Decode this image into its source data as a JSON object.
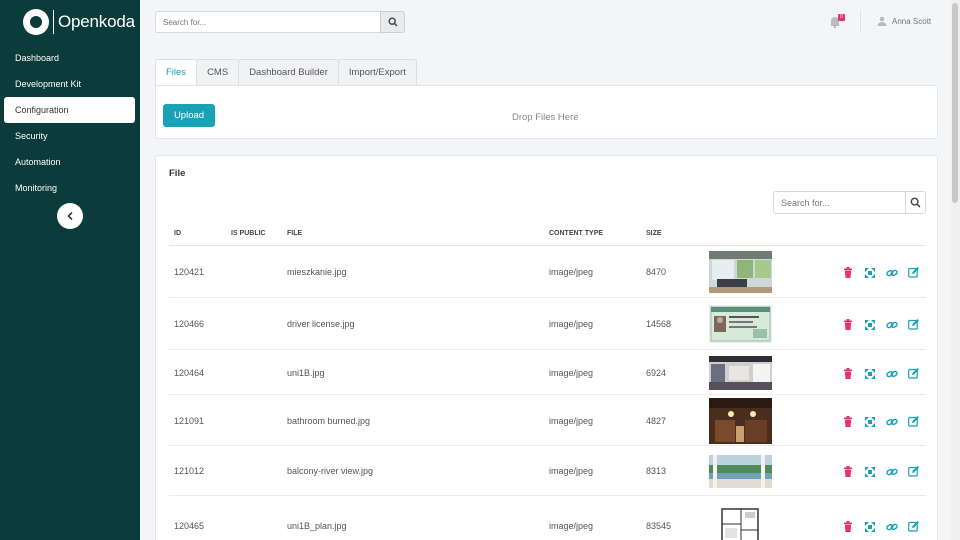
{
  "app": {
    "name": "Openkoda"
  },
  "sidebar": {
    "items": [
      {
        "label": "Dashboard"
      },
      {
        "label": "Development Kit"
      },
      {
        "label": "Configuration"
      },
      {
        "label": "Security"
      },
      {
        "label": "Automation"
      },
      {
        "label": "Monitoring"
      }
    ],
    "active": "Configuration"
  },
  "topbar": {
    "search_placeholder": "Search for...",
    "notifications_count": "0",
    "user_name": "Anna Scott"
  },
  "tabs": [
    {
      "label": "Files"
    },
    {
      "label": "CMS"
    },
    {
      "label": "Dashboard Builder"
    },
    {
      "label": "Import/Export"
    }
  ],
  "upload": {
    "button_label": "Upload",
    "drop_text": "Drop Files Here"
  },
  "file_table": {
    "title": "File",
    "search_placeholder": "Search for...",
    "columns": {
      "id": "ID",
      "is_public": "IS PUBLIC",
      "file": "FILE",
      "content_type": "CONTENT TYPE",
      "size": "SIZE"
    },
    "rows": [
      {
        "id": "120421",
        "file": "mieszkanie.jpg",
        "content_type": "image/jpeg",
        "size": "8470",
        "thumb": "living-room"
      },
      {
        "id": "120466",
        "file": "driver license.jpg",
        "content_type": "image/jpeg",
        "size": "14568",
        "thumb": "license"
      },
      {
        "id": "120464",
        "file": "uni1B.jpg",
        "content_type": "image/jpeg",
        "size": "6924",
        "thumb": "kitchen"
      },
      {
        "id": "121091",
        "file": "bathroom burned.jpg",
        "content_type": "image/jpeg",
        "size": "4827",
        "thumb": "bathroom"
      },
      {
        "id": "121012",
        "file": "balcony-river view.jpg",
        "content_type": "image/jpeg",
        "size": "8313",
        "thumb": "river"
      },
      {
        "id": "120465",
        "file": "uni1B_plan.jpg",
        "content_type": "image/jpeg",
        "size": "83545",
        "thumb": "floor-plan"
      }
    ]
  },
  "colors": {
    "sidebar": "#0b3b3a",
    "accent": "#17a2b8",
    "delete": "#e8336a",
    "action": "#17a2b8"
  }
}
